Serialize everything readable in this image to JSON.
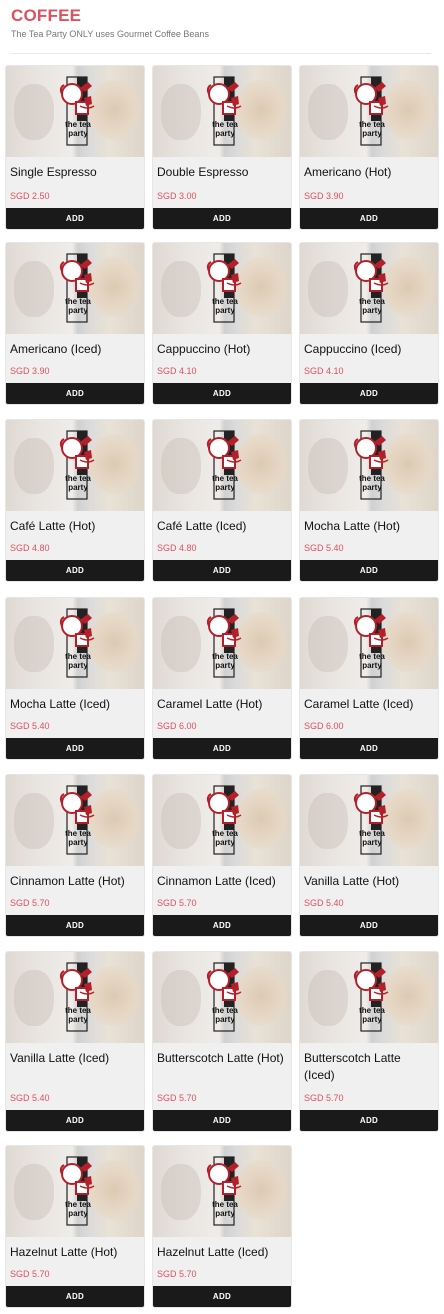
{
  "section": {
    "title": "COFFEE",
    "subtitle": "The Tea Party ONLY uses Gourmet Coffee Beans"
  },
  "logo_text": [
    "the tea",
    "party"
  ],
  "add_label": "ADD",
  "colors": {
    "accent": "#e0505e",
    "button": "#1a1a1a"
  },
  "products": [
    {
      "name": "Single Espresso",
      "price": "SGD 2.50"
    },
    {
      "name": "Double Espresso",
      "price": "SGD 3.00"
    },
    {
      "name": "Americano (Hot)",
      "price": "SGD 3.90"
    },
    {
      "name": "Americano (Iced)",
      "price": "SGD 3.90"
    },
    {
      "name": "Cappuccino (Hot)",
      "price": "SGD 4.10"
    },
    {
      "name": "Cappuccino (Iced)",
      "price": "SGD 4.10"
    },
    {
      "name": "Café Latte (Hot)",
      "price": "SGD 4.80"
    },
    {
      "name": "Café Latte (Iced)",
      "price": "SGD 4.80"
    },
    {
      "name": "Mocha Latte (Hot)",
      "price": "SGD 5.40"
    },
    {
      "name": "Mocha Latte (Iced)",
      "price": "SGD 5.40"
    },
    {
      "name": "Caramel Latte (Hot)",
      "price": "SGD 6.00"
    },
    {
      "name": "Caramel Latte (Iced)",
      "price": "SGD 6.00"
    },
    {
      "name": "Cinnamon Latte (Hot)",
      "price": "SGD 5.70"
    },
    {
      "name": "Cinnamon Latte (Iced)",
      "price": "SGD 5.70"
    },
    {
      "name": "Vanilla Latte (Hot)",
      "price": "SGD 5.40"
    },
    {
      "name": "Vanilla Latte (Iced)",
      "price": "SGD 5.40"
    },
    {
      "name": "Butterscotch Latte (Hot)",
      "price": "SGD 5.70"
    },
    {
      "name": "Butterscotch Latte (Iced)",
      "price": "SGD 5.70"
    },
    {
      "name": "Hazelnut Latte (Hot)",
      "price": "SGD 5.70"
    },
    {
      "name": "Hazelnut Latte (Iced)",
      "price": "SGD 5.70"
    }
  ]
}
